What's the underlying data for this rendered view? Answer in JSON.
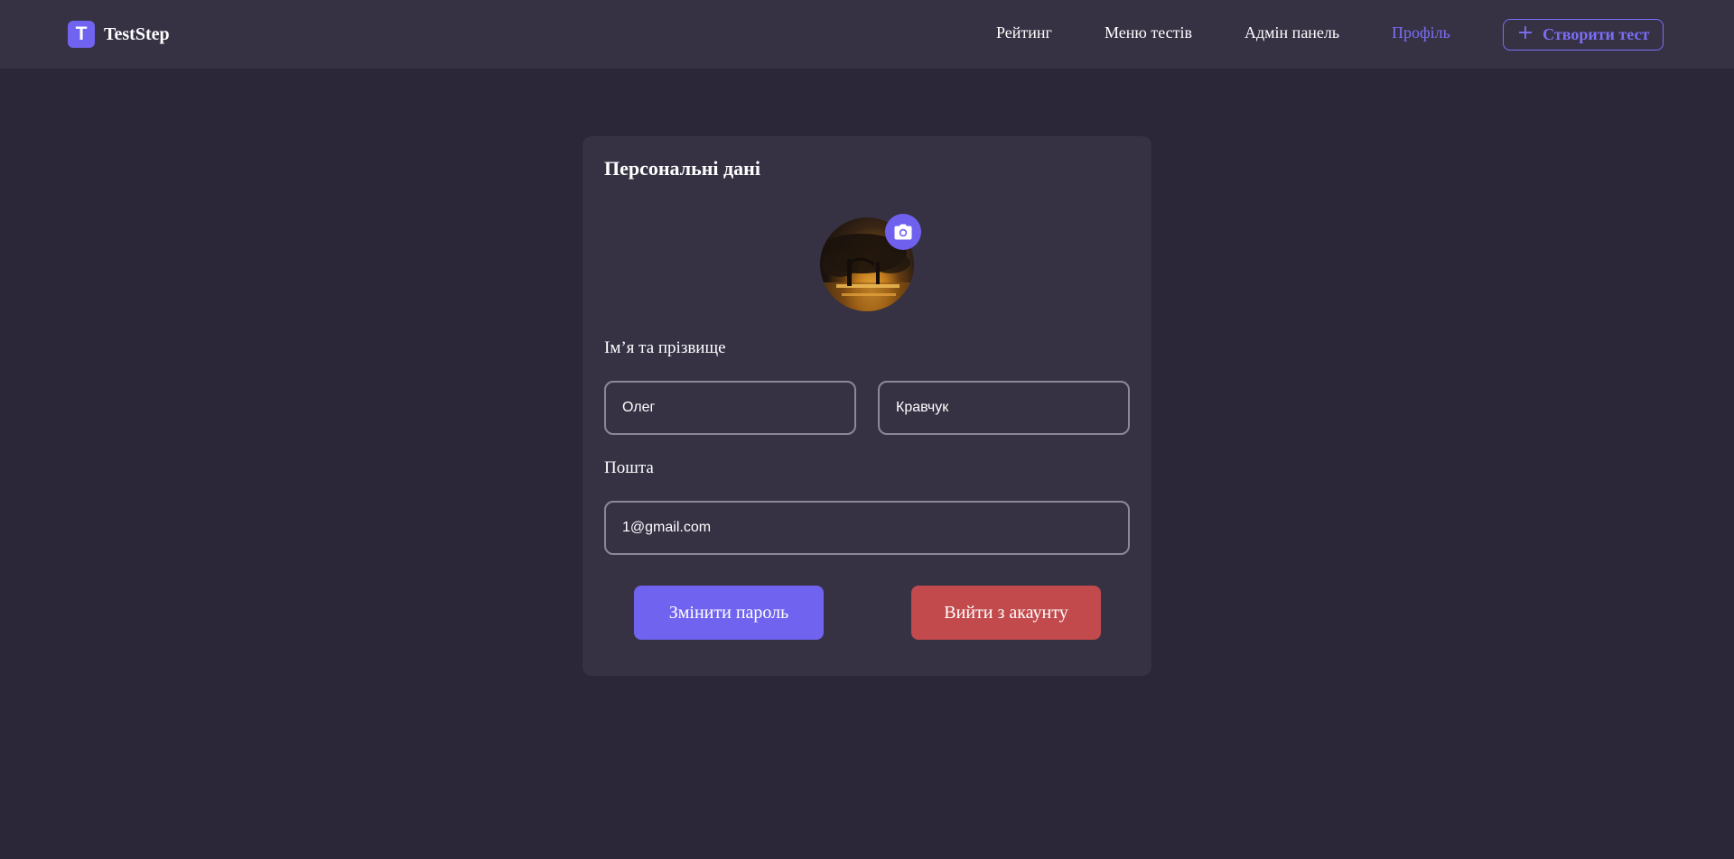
{
  "header": {
    "logo_letter": "T",
    "brand": "TestStep",
    "nav": [
      {
        "label": "Рейтинг"
      },
      {
        "label": "Меню тестів"
      },
      {
        "label": "Адмін панель"
      },
      {
        "label": "Профіль",
        "active": true
      }
    ],
    "create_label": "Створити тест"
  },
  "profile": {
    "title": "Персональні дані",
    "name_label": "Ім’я та прізвище",
    "first_name": "Олег",
    "last_name": "Кравчук",
    "email_label": "Пошта",
    "email": "1@gmail.com",
    "change_password_label": "Змінити пароль",
    "logout_label": "Вийти з акаунту"
  },
  "colors": {
    "accent": "#7063f0",
    "danger": "#c24a4d",
    "background": "#2b2738",
    "surface": "#363244"
  },
  "icons": {
    "create": "plus-icon",
    "avatar_upload": "camera-icon"
  }
}
